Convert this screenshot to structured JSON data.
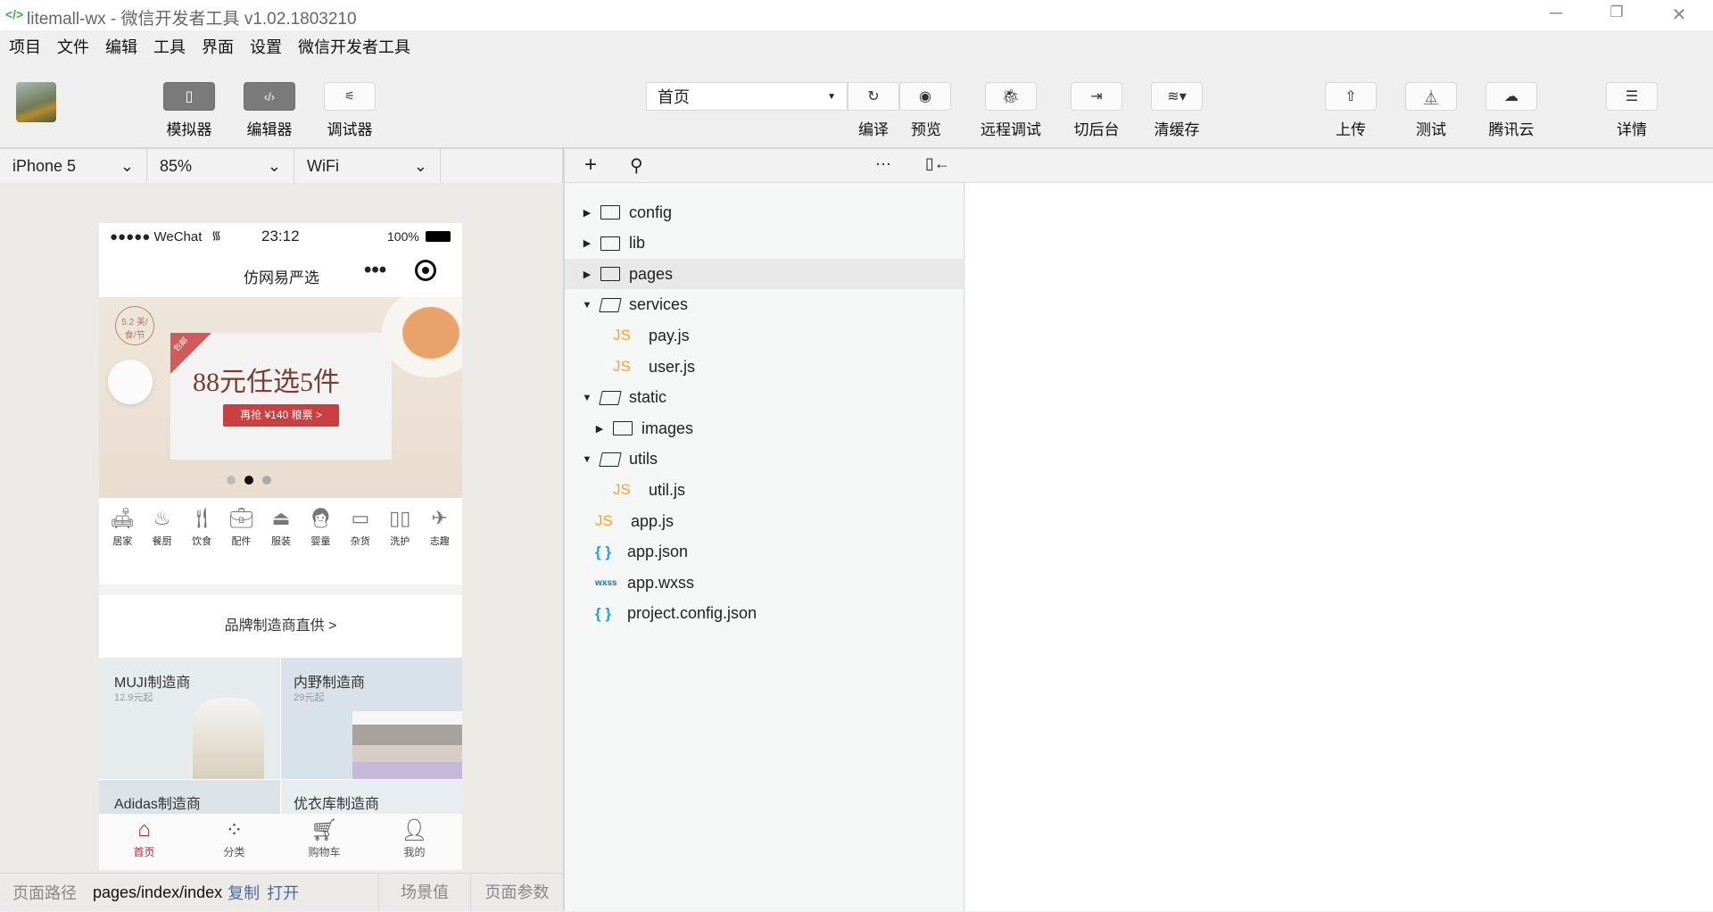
{
  "window": {
    "title": "litemall-wx - 微信开发者工具 v1.02.1803210",
    "logo": "</>",
    "controls": [
      "minimize-icon",
      "restore-icon",
      "close-icon"
    ]
  },
  "menu": [
    "项目",
    "文件",
    "编辑",
    "工具",
    "界面",
    "设置",
    "微信开发者工具"
  ],
  "toolbar": {
    "simulator": "模拟器",
    "editor": "编辑器",
    "debugger": "调试器",
    "page_select": "首页",
    "compile": "编译",
    "preview": "预览",
    "remote_debug": "远程调试",
    "background": "切后台",
    "clear_cache": "清缓存",
    "upload": "上传",
    "test": "测试",
    "tencent_cloud": "腾讯云",
    "details": "详情"
  },
  "device_bar": {
    "device": "iPhone 5",
    "zoom": "85%",
    "network": "WiFi"
  },
  "phone": {
    "status": {
      "carrier": "●●●●● WeChat",
      "time": "23:12",
      "battery": "100%"
    },
    "nav_title": "仿网易严选",
    "nav_more": "•••",
    "banner": {
      "badge": "5.2 美/食/节",
      "corner": "包邮",
      "headline": "88元任选5件",
      "button": "再抢 ¥140 粮票 >",
      "active_dot": 1,
      "dots": 3
    },
    "categories": [
      "居家",
      "餐厨",
      "饮食",
      "配件",
      "服装",
      "婴童",
      "杂货",
      "洗护",
      "志趣"
    ],
    "brand_header": "品牌制造商直供 >",
    "brands": [
      {
        "name": "MUJI制造商",
        "price": "12.9元起",
        "color": "#e6ebee"
      },
      {
        "name": "内野制造商",
        "price": "29元起",
        "color": "#d9e2ea"
      },
      {
        "name": "Adidas制造商",
        "price": "",
        "color": "#dbe3e8"
      },
      {
        "name": "优衣库制造商",
        "price": "",
        "color": "#e8edf2"
      }
    ],
    "tabs": [
      {
        "label": "首页",
        "active": true
      },
      {
        "label": "分类"
      },
      {
        "label": "购物车"
      },
      {
        "label": "我的"
      }
    ],
    "accent": "#b4282d"
  },
  "tree": [
    {
      "name": "config",
      "type": "folder",
      "open": false,
      "depth": 0
    },
    {
      "name": "lib",
      "type": "folder",
      "open": false,
      "depth": 0
    },
    {
      "name": "pages",
      "type": "folder",
      "open": false,
      "depth": 0,
      "selected": true
    },
    {
      "name": "services",
      "type": "folder",
      "open": true,
      "depth": 0
    },
    {
      "name": "pay.js",
      "type": "js",
      "depth": 1
    },
    {
      "name": "user.js",
      "type": "js",
      "depth": 1
    },
    {
      "name": "static",
      "type": "folder",
      "open": true,
      "depth": 0
    },
    {
      "name": "images",
      "type": "folder",
      "open": false,
      "depth": 1
    },
    {
      "name": "utils",
      "type": "folder",
      "open": true,
      "depth": 0
    },
    {
      "name": "util.js",
      "type": "js",
      "depth": 1
    },
    {
      "name": "app.js",
      "type": "js",
      "depth": 0
    },
    {
      "name": "app.json",
      "type": "json",
      "depth": 0
    },
    {
      "name": "app.wxss",
      "type": "wxss",
      "depth": 0
    },
    {
      "name": "project.config.json",
      "type": "json",
      "depth": 0
    }
  ],
  "file_icons": {
    "js": "JS",
    "json": "{ }",
    "wxss": "wxss"
  },
  "status": {
    "path_label": "页面路径",
    "path": "pages/index/index",
    "copy": "复制",
    "open": "打开",
    "scene": "场景值",
    "params": "页面参数"
  }
}
